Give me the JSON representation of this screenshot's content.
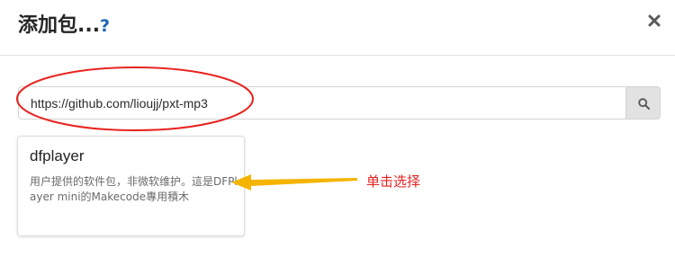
{
  "dialog": {
    "title": "添加包...",
    "help_icon": "?",
    "close_icon": "close-icon"
  },
  "search": {
    "value": "https://github.com/lioujj/pxt-mp3",
    "button_icon": "search-icon"
  },
  "package": {
    "name": "dfplayer",
    "description": "用户提供的软件包，非微软维护。這是DFPlayer mini的Makecode專用積木"
  },
  "annotation": {
    "text": "单击选择",
    "color": "#e8231f"
  },
  "colors": {
    "highlight_ellipse": "#e8231f",
    "arrow": "#f5b400",
    "help_icon": "#1f63b5"
  }
}
